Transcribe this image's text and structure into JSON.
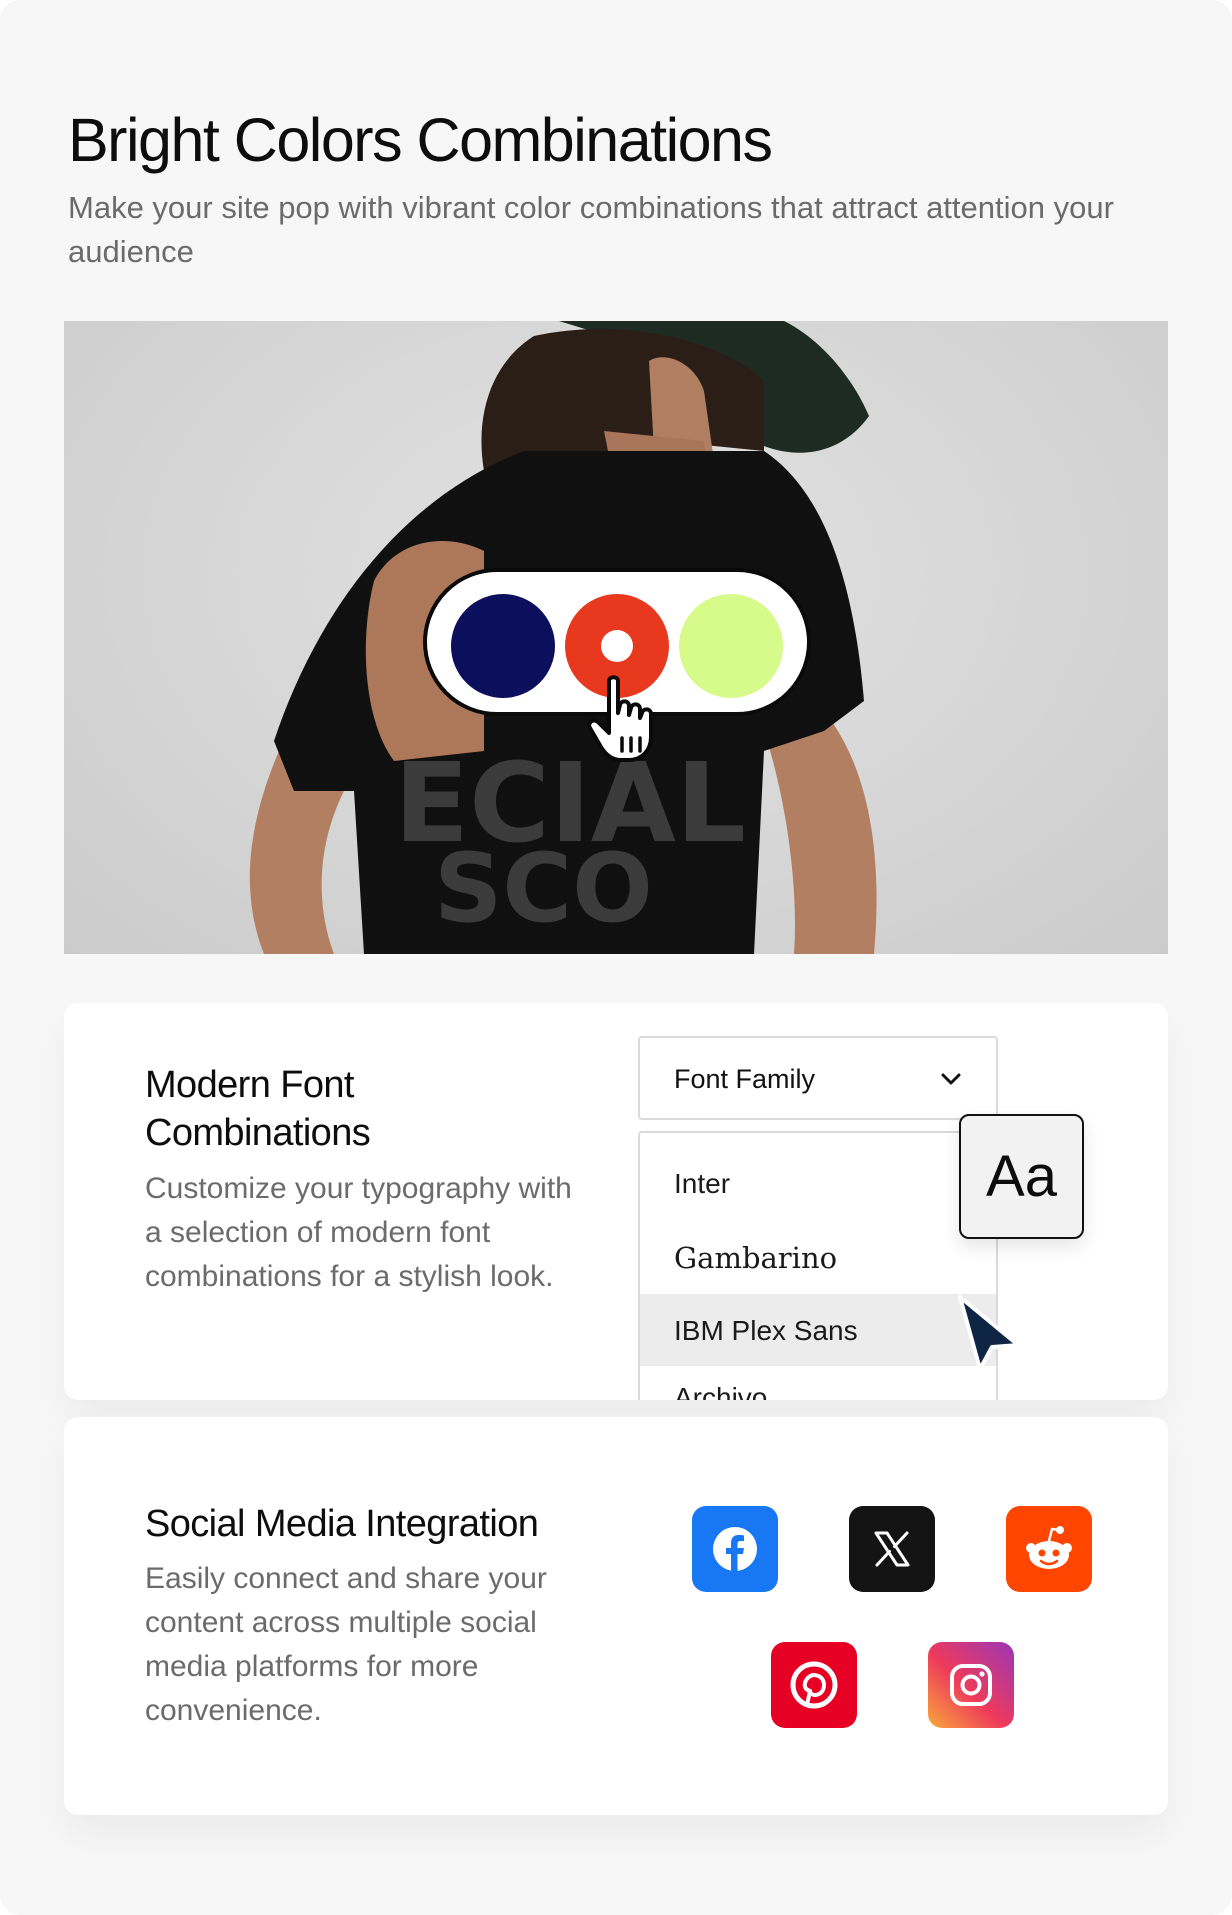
{
  "hero": {
    "title": "Bright Colors Combinations",
    "subtitle": "Make your site pop with vibrant color combinations that attract attention your audience"
  },
  "color_picker": {
    "swatches": [
      {
        "name": "navy",
        "color": "#0b0f5c"
      },
      {
        "name": "red",
        "color": "#e8391e",
        "selected": true
      },
      {
        "name": "lime",
        "color": "#d6fb8a"
      }
    ]
  },
  "font_card": {
    "title": "Modern Font Combinations",
    "text": "Customize your typography with a selection of modern font combinations for a stylish look.",
    "select_label": "Font Family",
    "options": [
      "Inter",
      "Gambarino",
      "IBM Plex Sans",
      "Archivo"
    ],
    "highlighted_option": "IBM Plex Sans",
    "preview": "Aa"
  },
  "social_card": {
    "title": "Social Media Integration",
    "text": "Easily connect and share your content across multiple social media platforms for more convenience.",
    "icons": [
      {
        "name": "facebook-icon",
        "color": "#1877f2"
      },
      {
        "name": "x-icon",
        "color": "#141414"
      },
      {
        "name": "reddit-icon",
        "color": "#ff4500"
      },
      {
        "name": "pinterest-icon",
        "color": "#e60023"
      },
      {
        "name": "instagram-icon",
        "color": "#e1306c"
      }
    ]
  },
  "colors": {
    "page_bg": "#f7f7f7",
    "card_bg": "#ffffff",
    "muted_text": "#6b6b6b",
    "cursor_navy": "#0f2544"
  }
}
